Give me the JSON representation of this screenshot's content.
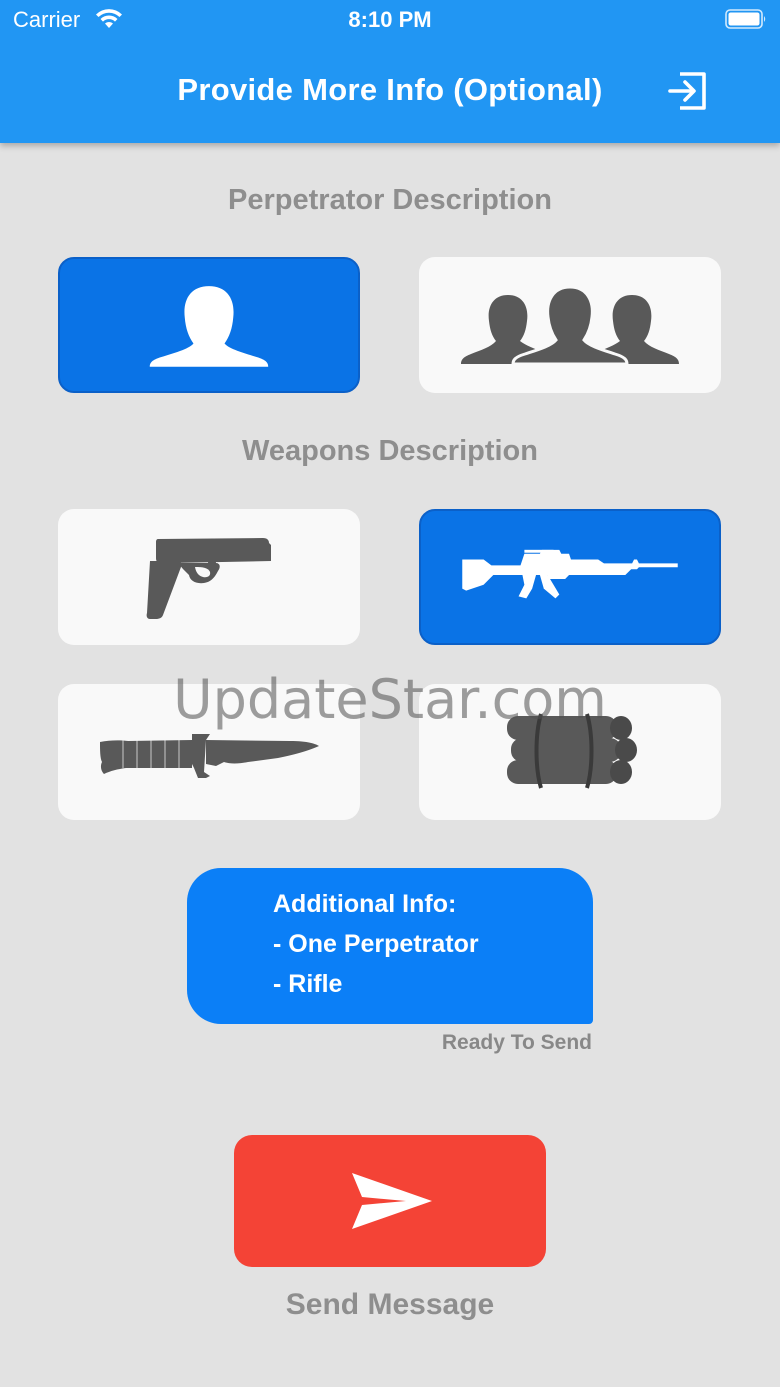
{
  "status_bar": {
    "carrier": "Carrier",
    "time": "8:10 PM",
    "wifi_icon": "wifi-icon",
    "battery_icon": "battery-icon"
  },
  "nav": {
    "title": "Provide More Info (Optional)",
    "exit_icon": "exit-icon"
  },
  "perpetrator": {
    "title": "Perpetrator Description",
    "options": [
      {
        "icon": "single-person-icon",
        "selected": true
      },
      {
        "icon": "group-people-icon",
        "selected": false
      }
    ]
  },
  "weapons": {
    "title": "Weapons Description",
    "options": [
      {
        "icon": "pistol-icon",
        "selected": false
      },
      {
        "icon": "rifle-icon",
        "selected": true
      },
      {
        "icon": "knife-icon",
        "selected": false
      },
      {
        "icon": "explosives-icon",
        "selected": false
      }
    ]
  },
  "info": {
    "lines": [
      "Additional Info:",
      "- One Perpetrator",
      "- Rifle"
    ],
    "status": "Ready To Send"
  },
  "send": {
    "label": "Send Message",
    "icon": "send-icon"
  },
  "watermark": "UpdateStar.com",
  "colors": {
    "header": "#2196f3",
    "background": "#e2e2e2",
    "tile": "#f9f9f9",
    "selected": "#0a73e6",
    "info_card": "#0b7ff7",
    "send_button": "#f44336",
    "muted_text": "#8e8e8e",
    "icon_gray": "#595959"
  }
}
